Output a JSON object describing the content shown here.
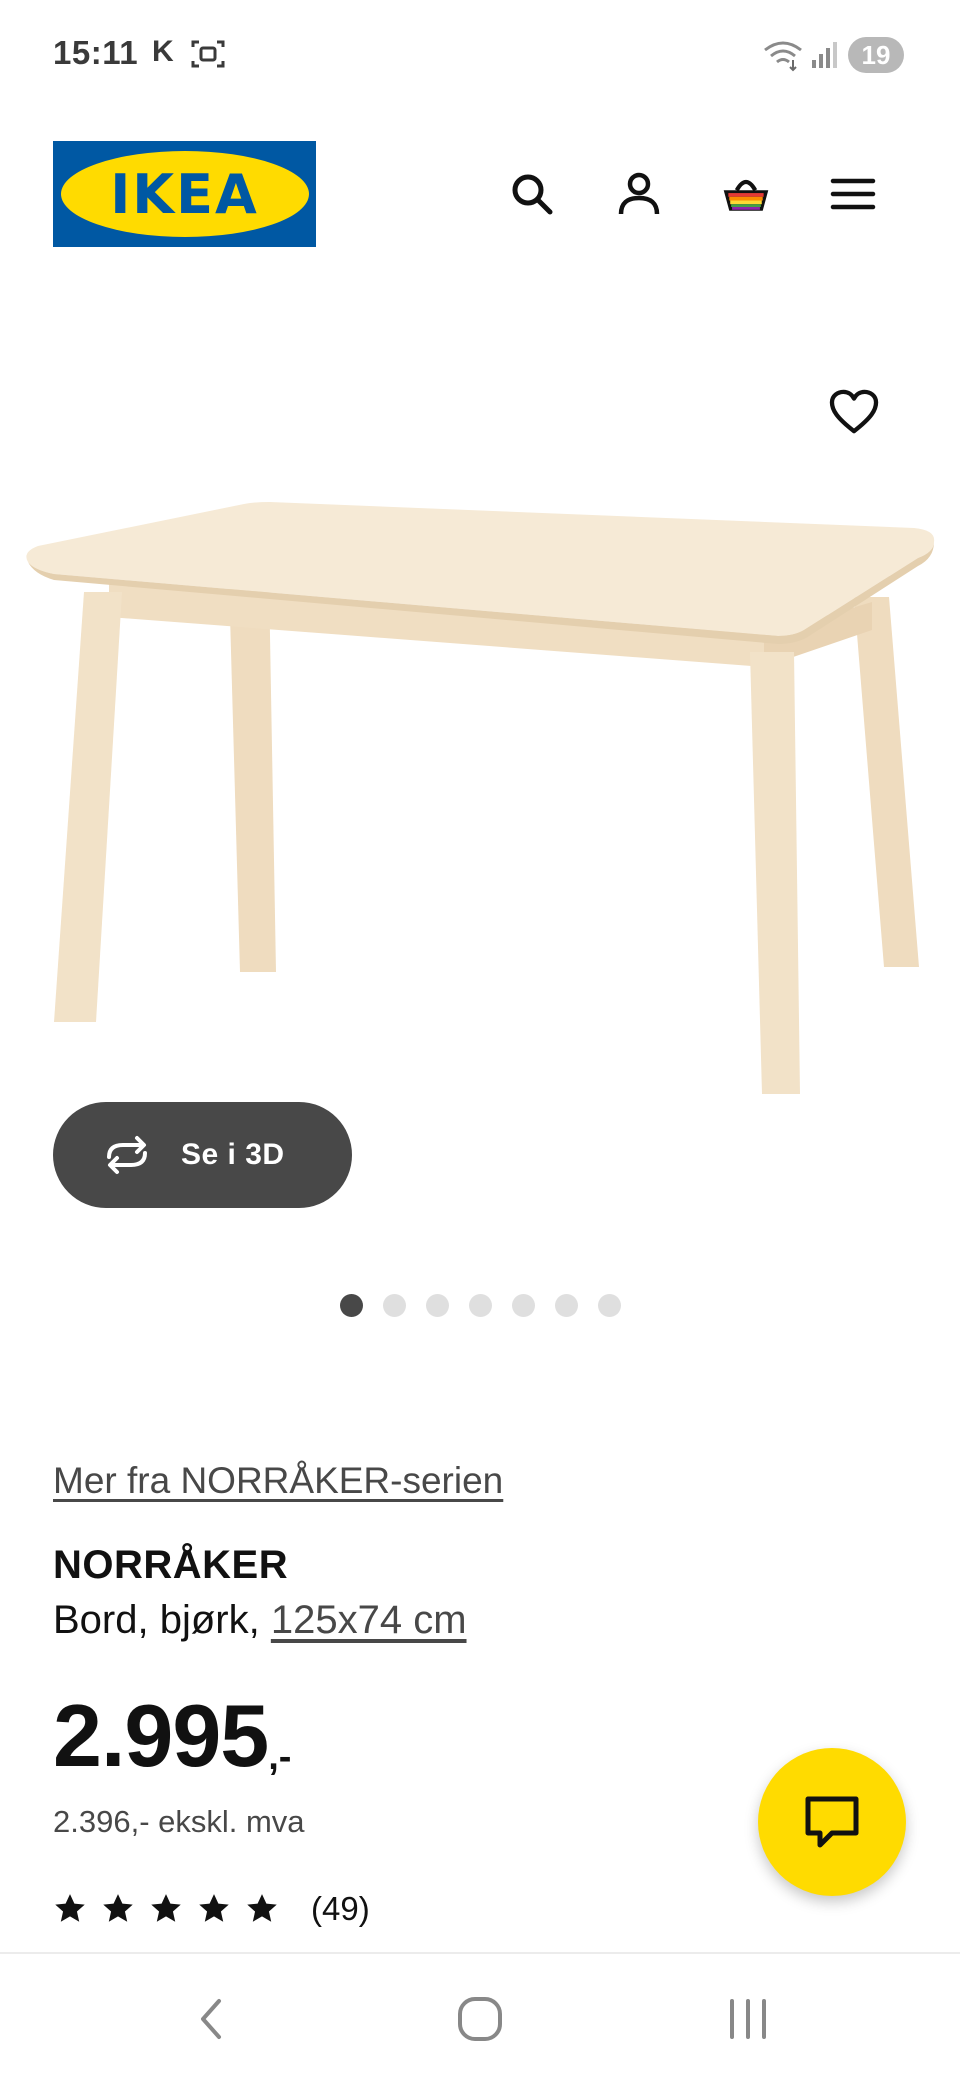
{
  "status_bar": {
    "time": "15:11",
    "carrier_letter": "K",
    "battery": "19",
    "icons": [
      "screenshot-icon",
      "wifi-icon",
      "signal-icon"
    ]
  },
  "header": {
    "logo_text": "IKEA",
    "icons": [
      "search-icon",
      "account-icon",
      "basket-icon",
      "menu-icon"
    ],
    "brand_blue": "#0058a3",
    "brand_yellow": "#ffdb00"
  },
  "gallery": {
    "view3d_label": "Se i 3D",
    "image_count": 7,
    "active_image": 1
  },
  "product": {
    "series_link": "Mer fra NORRÅKER-serien",
    "name": "NORRÅKER",
    "description": "Bord, bjørk,",
    "size_link": "125x74 cm",
    "price": "2.995",
    "price_suffix": ",-",
    "price_ex_vat": "2.396,- ekskl. mva",
    "rating_stars": 5,
    "rating_count": "(49)"
  },
  "colors": {
    "accent_dark": "#484848",
    "chat_fab": "#ffdb00"
  }
}
